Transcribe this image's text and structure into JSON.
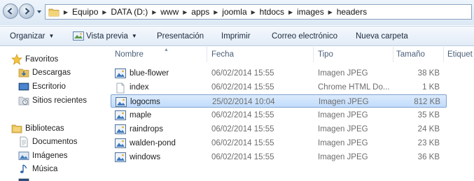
{
  "address": {
    "crumbs": [
      "Equipo",
      "DATA (D:)",
      "www",
      "apps",
      "joomla",
      "htdocs",
      "images",
      "headers"
    ]
  },
  "toolbar": {
    "organize": "Organizar",
    "preview": "Vista previa",
    "slideshow": "Presentación",
    "print": "Imprimir",
    "email": "Correo electrónico",
    "new_folder": "Nueva carpeta"
  },
  "navpane": {
    "favorites": "Favoritos",
    "downloads": "Descargas",
    "desktop": "Escritorio",
    "recent": "Sitios recientes",
    "libraries": "Bibliotecas",
    "documents": "Documentos",
    "images": "Imágenes",
    "music": "Música"
  },
  "columns": {
    "name": "Nombre",
    "date": "Fecha",
    "type": "Tipo",
    "size": "Tamaño",
    "tags": "Etiquet"
  },
  "files": [
    {
      "name": "blue-flower",
      "date": "06/02/2014 15:55",
      "type": "Imagen JPEG",
      "size": "38 KB",
      "icon": "jpeg-image-icon"
    },
    {
      "name": "index",
      "date": "06/02/2014 15:55",
      "type": "Chrome HTML Do...",
      "size": "1 KB",
      "icon": "html-document-icon"
    },
    {
      "name": "logocms",
      "date": "25/02/2014 10:04",
      "type": "Imagen JPEG",
      "size": "812 KB",
      "icon": "jpeg-image-icon"
    },
    {
      "name": "maple",
      "date": "06/02/2014 15:55",
      "type": "Imagen JPEG",
      "size": "35 KB",
      "icon": "jpeg-image-icon"
    },
    {
      "name": "raindrops",
      "date": "06/02/2014 15:55",
      "type": "Imagen JPEG",
      "size": "24 KB",
      "icon": "jpeg-image-icon"
    },
    {
      "name": "walden-pond",
      "date": "06/02/2014 15:55",
      "type": "Imagen JPEG",
      "size": "23 KB",
      "icon": "jpeg-image-icon"
    },
    {
      "name": "windows",
      "date": "06/02/2014 15:55",
      "type": "Imagen JPEG",
      "size": "36 KB",
      "icon": "jpeg-image-icon"
    }
  ],
  "selected_file": "logocms"
}
